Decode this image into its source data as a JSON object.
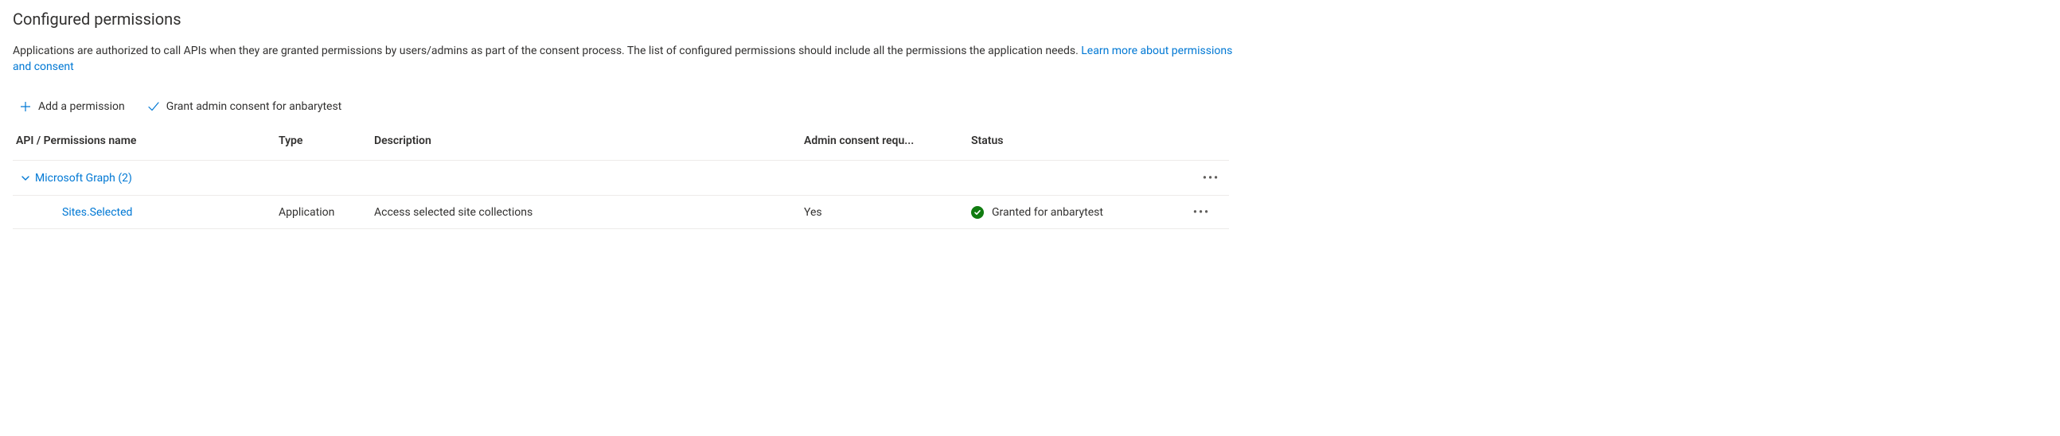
{
  "section": {
    "title": "Configured permissions",
    "description": "Applications are authorized to call APIs when they are granted permissions by users/admins as part of the consent process. The list of configured permissions should include all the permissions the application needs. ",
    "learnMoreLabel": "Learn more about permissions and consent"
  },
  "toolbar": {
    "addPermission": "Add a permission",
    "grantConsent": "Grant admin consent for anbarytest"
  },
  "table": {
    "headers": {
      "name": "API / Permissions name",
      "type": "Type",
      "description": "Description",
      "adminConsent": "Admin consent requ...",
      "status": "Status"
    },
    "group": {
      "label": "Microsoft Graph (2)"
    },
    "rows": [
      {
        "name": "Sites.Selected",
        "type": "Application",
        "description": "Access selected site collections",
        "adminConsent": "Yes",
        "status": "Granted for anbarytest"
      }
    ]
  }
}
